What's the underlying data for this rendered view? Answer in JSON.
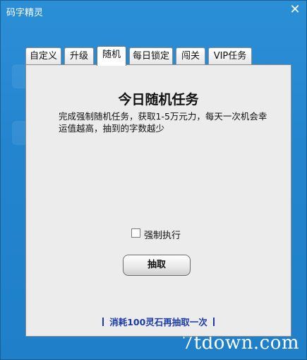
{
  "window": {
    "title": "码字精灵",
    "close_symbol": "✕"
  },
  "tabs": [
    {
      "label": "自定义",
      "active": false
    },
    {
      "label": "升级",
      "active": false
    },
    {
      "label": "随机",
      "active": true
    },
    {
      "label": "每日锁定",
      "active": false
    },
    {
      "label": "闯关",
      "active": false
    },
    {
      "label": "VIP任务",
      "active": false
    }
  ],
  "panel": {
    "title": "今日随机任务",
    "description": "完成强制随机任务，获取1-5万元力，每天一次机会幸运值越高，抽到的字数越少",
    "checkbox_label": "强制执行",
    "checkbox_checked": false,
    "draw_button": "抽取",
    "redraw_link": "消耗100灵石再抽取一次"
  },
  "watermark": "7tdown.com"
}
